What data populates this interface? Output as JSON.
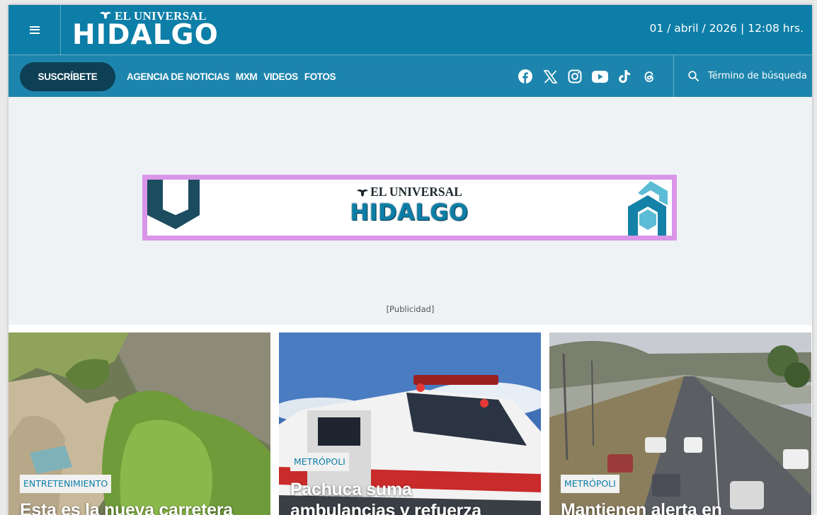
{
  "header": {
    "brand_top": "EL UNIVERSAL",
    "brand_main": "HIDALGO",
    "datetime": "01 / abril / 2026 | 12:08 hrs."
  },
  "nav": {
    "subscribe_label": "SUSCRÍBETE",
    "links": [
      "AGENCIA DE NOTICIAS",
      "MXM",
      "VIDEOS",
      "FOTOS"
    ],
    "social_icons": [
      "facebook-icon",
      "x-icon",
      "instagram-icon",
      "youtube-icon",
      "tiktok-icon",
      "threads-icon"
    ],
    "search_placeholder": "Término de búsqueda"
  },
  "ad": {
    "brand_top": "EL UNIVERSAL",
    "brand_main": "HIDALGO",
    "label": "[Publicidad]"
  },
  "cards": [
    {
      "tag": "ENTRETENIMIENTO",
      "headline": "Esta es la nueva carretera"
    },
    {
      "tag": "METRÓPOLI",
      "headline_line1": "Pachuca suma",
      "headline_line2": "ambulancias y refuerza"
    },
    {
      "tag": "METRÓPOLI",
      "headline": "Mantienen alerta en"
    }
  ],
  "colors": {
    "header_bg": "#0d7ea7",
    "nav_bg": "#1d85ad",
    "subscribe_bg": "#0d3f55",
    "ad_border": "#d996e8"
  }
}
